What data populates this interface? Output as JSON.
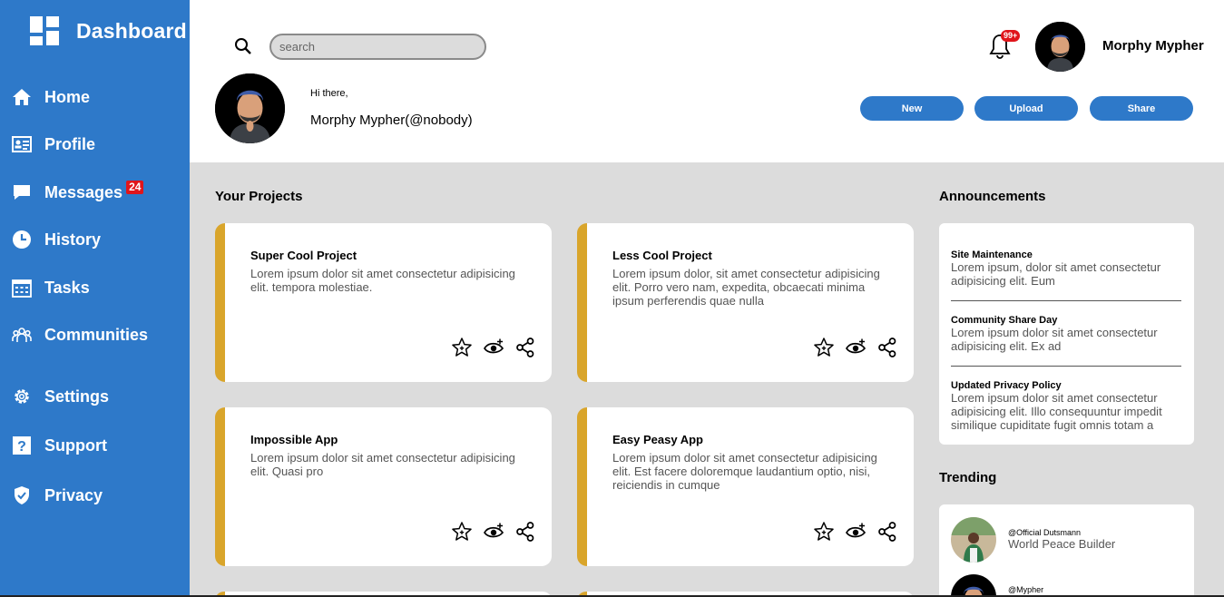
{
  "sidebar": {
    "brand": "Dashboard",
    "items": [
      {
        "label": "Home",
        "icon": "home-icon"
      },
      {
        "label": "Profile",
        "icon": "id-card-icon"
      },
      {
        "label": "Messages",
        "icon": "chat-icon",
        "badge": "24"
      },
      {
        "label": "History",
        "icon": "clock-icon"
      },
      {
        "label": "Tasks",
        "icon": "calendar-icon"
      },
      {
        "label": "Communities",
        "icon": "people-icon"
      },
      {
        "label": "Settings",
        "icon": "gear-icon"
      },
      {
        "label": "Support",
        "icon": "help-icon"
      },
      {
        "label": "Privacy",
        "icon": "shield-icon"
      }
    ]
  },
  "header": {
    "search_placeholder": "search",
    "notifications_badge": "99+",
    "username": "Morphy Mypher",
    "greeting": "Hi there,",
    "full_handle": "Morphy Mypher(@nobody)",
    "actions": [
      "New",
      "Upload",
      "Share"
    ]
  },
  "projects": {
    "title": "Your Projects",
    "cards": [
      {
        "title": "Super Cool Project",
        "desc": "Lorem ipsum dolor sit amet consectetur adipisicing elit. tempora molestiae."
      },
      {
        "title": "Less Cool Project",
        "desc": "Lorem ipsum dolor, sit amet consectetur adipisicing elit. Porro vero nam, expedita, obcaecati minima ipsum perferendis quae nulla"
      },
      {
        "title": "Impossible App",
        "desc": "Lorem ipsum dolor sit amet consectetur adipisicing elit. Quasi pro"
      },
      {
        "title": "Easy Peasy App",
        "desc": "Lorem ipsum dolor sit amet consectetur adipisicing elit. Est facere doloremque laudantium optio, nisi, reiciendis in cumque"
      }
    ]
  },
  "announcements": {
    "title": "Announcements",
    "items": [
      {
        "title": "Site Maintenance",
        "body": "Lorem ipsum, dolor sit amet consectetur adipisicing elit. Eum"
      },
      {
        "title": "Community Share Day",
        "body": "Lorem ipsum dolor sit amet consectetur adipisicing elit. Ex ad"
      },
      {
        "title": "Updated Privacy Policy",
        "body": "Lorem ipsum dolor sit amet consectetur adipisicing elit. Illo consequuntur impedit similique cupiditate fugit omnis totam a"
      }
    ]
  },
  "trending": {
    "title": "Trending",
    "items": [
      {
        "handle": "@Official Dutsmann",
        "desc": "World Peace Builder"
      },
      {
        "handle": "@Mypher",
        "desc": ""
      }
    ]
  },
  "colors": {
    "primary": "#2e79c9",
    "accent": "#d9a52b",
    "background": "#dcdcdc",
    "badge": "#e0151b"
  }
}
